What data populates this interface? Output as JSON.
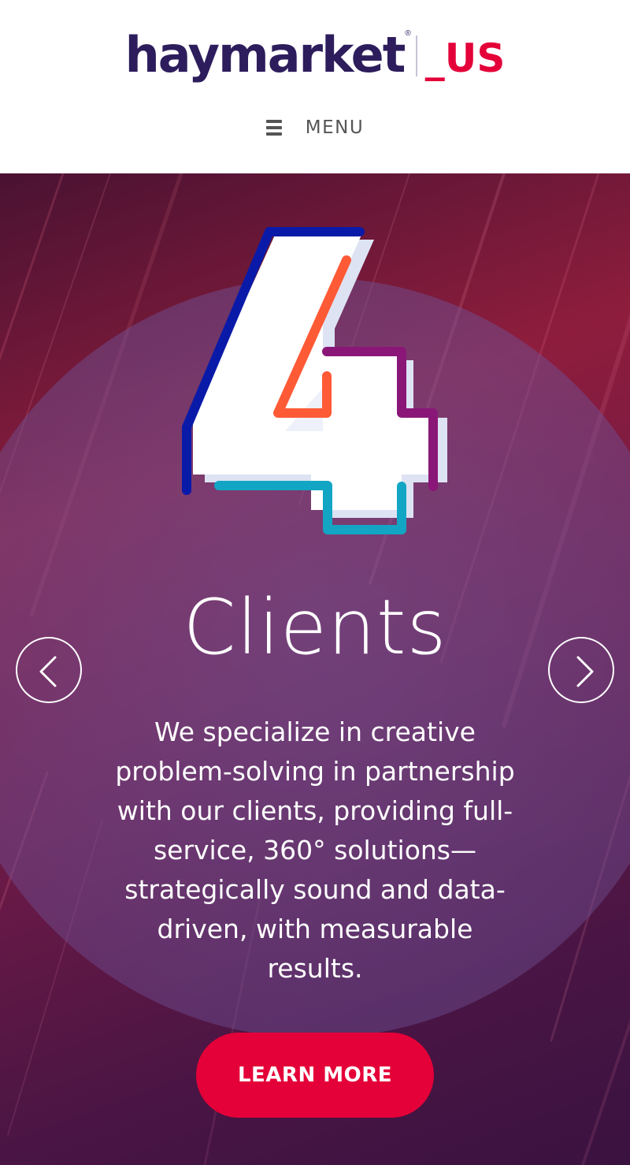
{
  "logo": {
    "brand": "haymarket",
    "registered": "®",
    "region": "_US"
  },
  "nav": {
    "menu_label": "MENU"
  },
  "hero": {
    "number": "4",
    "title": "Clients",
    "description": "We specialize in creative problem-solving in partnership with our clients, providing full-service, 360° solutions—strategically sound and data-driven, with measurable results.",
    "cta_label": "LEARN MORE"
  },
  "colors": {
    "brand_navy": "#2d1d5c",
    "brand_red": "#e40038",
    "accent_blue": "#0a1aa8",
    "accent_orange": "#ff5a36",
    "accent_purple": "#8a1778",
    "accent_teal": "#12a6c4"
  },
  "icons": {
    "menu": "hamburger-icon",
    "prev": "chevron-left-icon",
    "next": "chevron-right-icon"
  }
}
